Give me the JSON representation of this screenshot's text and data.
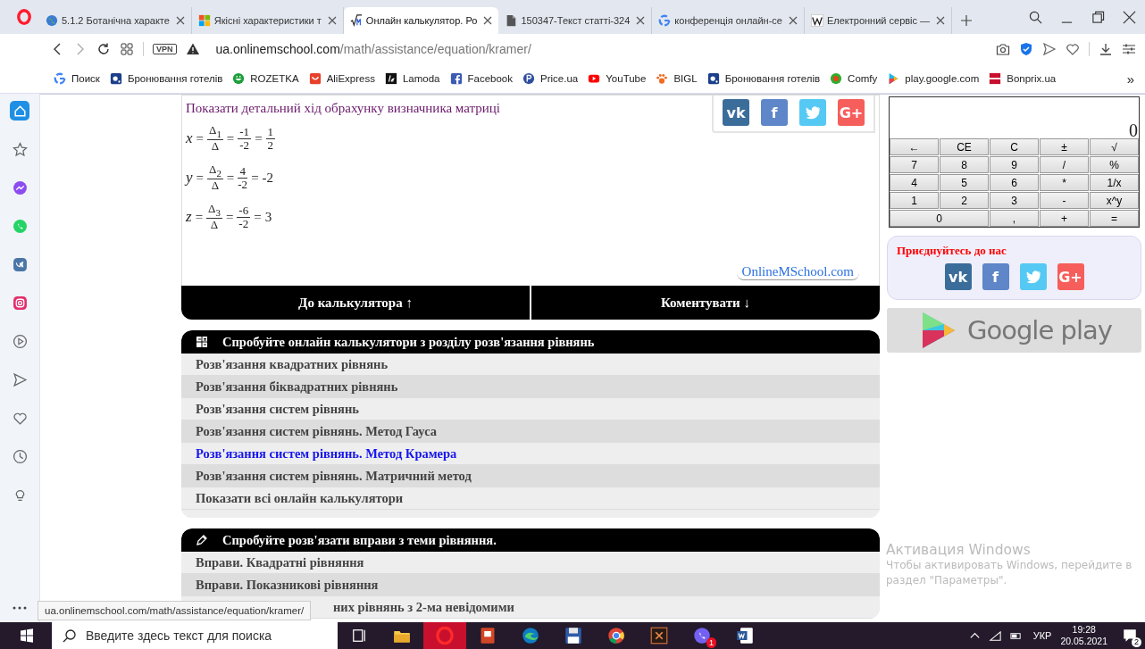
{
  "browser": {
    "tabs": [
      {
        "title": "5.1.2 Ботанічна характе",
        "kind": "globe",
        "selected": false
      },
      {
        "title": "Якісні характеристики т",
        "kind": "squares",
        "selected": false
      },
      {
        "title": "Онлайн калькулятор. Ро",
        "kind": "math",
        "selected": true
      },
      {
        "title": "150347-Текст статті-324",
        "kind": "doc",
        "selected": false
      },
      {
        "title": "конференція онлайн-се",
        "kind": "google",
        "selected": false
      },
      {
        "title": "Електронний сервіс —",
        "kind": "wiki",
        "selected": false
      }
    ],
    "vpn": "VPN",
    "url_host": "ua.onlinemschool.com",
    "url_path": "/math/assistance/equation/kramer/",
    "bookmarks": [
      {
        "label": "Поиск",
        "kind": "google"
      },
      {
        "label": "Бронювання готелів",
        "kind": "booking"
      },
      {
        "label": "ROZETKA",
        "kind": "rozetka"
      },
      {
        "label": "AliExpress",
        "kind": "ali"
      },
      {
        "label": "Lamoda",
        "kind": "lamoda"
      },
      {
        "label": "Facebook",
        "kind": "facebook"
      },
      {
        "label": "Price.ua",
        "kind": "price"
      },
      {
        "label": "YouTube",
        "kind": "youtube"
      },
      {
        "label": "BIGL",
        "kind": "paw"
      },
      {
        "label": "Бронювання готелів",
        "kind": "booking"
      },
      {
        "label": "Comfy",
        "kind": "comfy"
      },
      {
        "label": "play.google.com",
        "kind": "play"
      },
      {
        "label": "Bonprix.ua",
        "kind": "bonprix"
      }
    ],
    "more": "»",
    "sidebar": [
      {
        "kind": "home",
        "selected": true
      },
      {
        "kind": "star",
        "selected": false
      },
      {
        "kind": "messenger",
        "selected": false
      },
      {
        "kind": "whatsapp",
        "selected": false
      },
      {
        "kind": "vk",
        "selected": false
      },
      {
        "kind": "instagram",
        "selected": false
      },
      {
        "kind": "player",
        "selected": false
      },
      {
        "kind": "send",
        "selected": false
      },
      {
        "kind": "heart",
        "selected": false
      },
      {
        "kind": "clock",
        "selected": false
      },
      {
        "kind": "bulb",
        "selected": false
      }
    ],
    "status_url": "ua.onlinemschool.com/math/assistance/equation/kramer/"
  },
  "page": {
    "detail_link": "Показати детальний хід обрахунку визначника матриці",
    "share": [
      {
        "kind": "vk",
        "label": "vk"
      },
      {
        "kind": "facebook",
        "label": "f"
      },
      {
        "kind": "twitter"
      },
      {
        "kind": "gplus",
        "label": "G+"
      }
    ],
    "equations": [
      {
        "var": "x",
        "sign": "=",
        "parts": [
          {
            "kind": "fraction",
            "num": "Δ$_{1}$",
            "den": "Δ"
          },
          {
            "kind": "fraction",
            "num": "-1",
            "den": "-2"
          },
          {
            "kind": "fraction",
            "num": "1",
            "den": "2"
          }
        ]
      },
      {
        "var": "y",
        "sign": "=",
        "parts": [
          {
            "kind": "fraction",
            "num": "Δ$_{2}$",
            "den": "Δ"
          },
          {
            "kind": "fraction",
            "num": "4",
            "den": "-2"
          },
          {
            "kind": "value",
            "text": "-2"
          }
        ]
      },
      {
        "var": "z",
        "sign": "=",
        "parts": [
          {
            "kind": "fraction",
            "num": "Δ$_{3}$",
            "den": "Δ"
          },
          {
            "kind": "fraction",
            "num": "-6",
            "den": "-2"
          },
          {
            "kind": "value",
            "text": "3"
          }
        ]
      }
    ],
    "site_link": "OnlineMSchool.com",
    "nav_buttons": [
      "До калькулятора ↑",
      "Коментувати ↓"
    ],
    "sections": [
      {
        "title": "Спробуйте онлайн калькулятори з розділу розв'язання рівнянь",
        "kind": "calc",
        "items": [
          {
            "label": "Розв'язання квадратних рівнянь",
            "selected": false
          },
          {
            "label": "Розв'язання біквадратних рівнянь",
            "selected": false
          },
          {
            "label": "Розв'язання систем рівнянь",
            "selected": false
          },
          {
            "label": "Розв'язання систем рівнянь. Метод Гауса",
            "selected": false
          },
          {
            "label": "Розв'язання систем рівнянь. Метод Крамера",
            "selected": true
          },
          {
            "label": "Розв'язання систем рівнянь. Матричний метод",
            "selected": false
          },
          {
            "label": "Показати всі онлайн калькулятори",
            "selected": false
          }
        ]
      },
      {
        "title": "Спробуйте розв'язати вправи з теми рівняння.",
        "kind": "pencil",
        "items": [
          {
            "label": "Вправи. Квадратні рівняння",
            "selected": false
          },
          {
            "label": "Вправи. Показникові рівняння",
            "selected": false
          },
          {
            "label": "них рівнянь з 2-ма невідомими",
            "selected": false,
            "covered": true
          }
        ]
      }
    ],
    "calculator": {
      "display": "0",
      "keys": [
        {
          "label": "←",
          "kind": "normal"
        },
        {
          "label": "CE",
          "kind": "normal"
        },
        {
          "label": "C",
          "kind": "normal"
        },
        {
          "label": "±",
          "kind": "normal"
        },
        {
          "label": "√",
          "kind": "normal"
        },
        {
          "label": "7",
          "kind": "normal"
        },
        {
          "label": "8",
          "kind": "normal"
        },
        {
          "label": "9",
          "kind": "normal"
        },
        {
          "label": "/",
          "kind": "normal"
        },
        {
          "label": "%",
          "kind": "normal"
        },
        {
          "label": "4",
          "kind": "normal"
        },
        {
          "label": "5",
          "kind": "normal"
        },
        {
          "label": "6",
          "kind": "normal"
        },
        {
          "label": "*",
          "kind": "normal"
        },
        {
          "label": "1/x",
          "kind": "normal"
        },
        {
          "label": "1",
          "kind": "normal"
        },
        {
          "label": "2",
          "kind": "normal"
        },
        {
          "label": "3",
          "kind": "normal"
        },
        {
          "label": "-",
          "kind": "normal"
        },
        {
          "label": "x^y",
          "kind": "normal"
        },
        {
          "label": "0",
          "kind": "wide"
        },
        {
          "label": ",",
          "kind": "normal"
        },
        {
          "label": "+",
          "kind": "normal"
        },
        {
          "label": "=",
          "kind": "normal"
        }
      ]
    },
    "join": {
      "title": "Приєднуйтесь до нас",
      "share": [
        {
          "kind": "vk",
          "label": "vk"
        },
        {
          "kind": "facebook",
          "label": "f"
        },
        {
          "kind": "twitter"
        },
        {
          "kind": "gplus",
          "label": "G+"
        }
      ]
    },
    "store_badge": "Google play"
  },
  "activation": {
    "title": "Активация Windows",
    "lines": [
      "Чтобы активировать Windows, перейдите в",
      "раздел \"Параметры\"."
    ]
  },
  "taskbar": {
    "search_placeholder": "Введите здесь текст для поиска",
    "apps": [
      {
        "kind": "taskview",
        "selected": false
      },
      {
        "kind": "folder",
        "selected": false
      },
      {
        "kind": "opera",
        "selected": true
      },
      {
        "kind": "slides",
        "selected": false
      },
      {
        "kind": "edge",
        "selected": false
      },
      {
        "kind": "disk",
        "selected": false
      },
      {
        "kind": "chrome",
        "selected": false
      },
      {
        "kind": "film",
        "selected": false
      },
      {
        "kind": "viber",
        "selected": false,
        "badge": "1"
      },
      {
        "kind": "word",
        "selected": false
      }
    ],
    "language": "УКР",
    "time": "19:28",
    "date": "20.05.2021",
    "notifications": "2"
  }
}
